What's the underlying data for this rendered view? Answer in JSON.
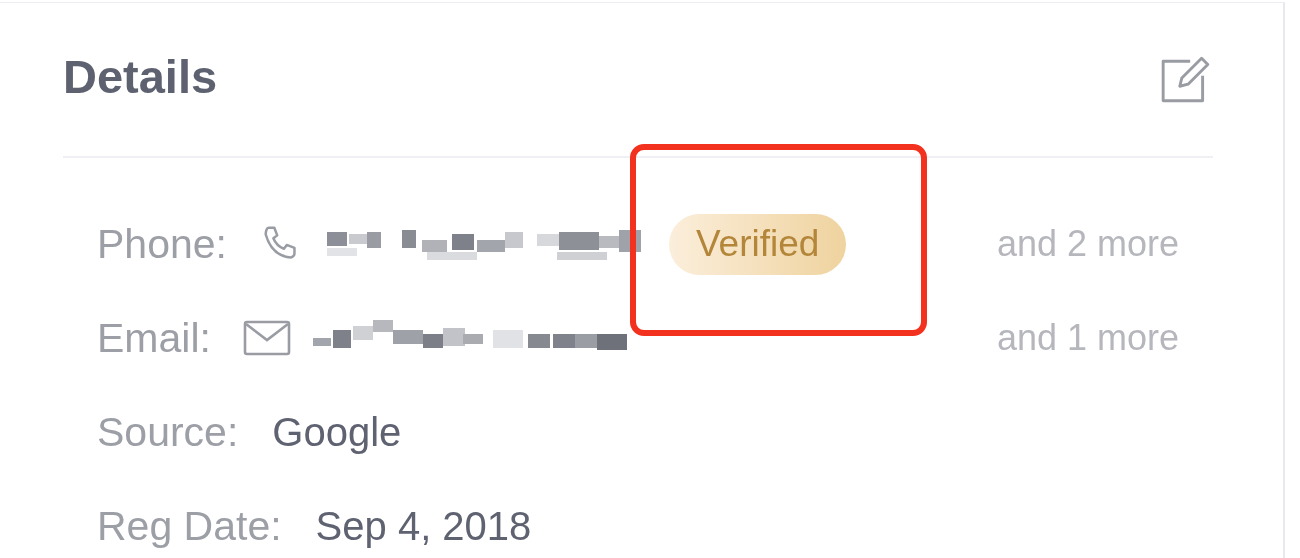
{
  "panel": {
    "title": "Details"
  },
  "fields": [
    {
      "kind": "phone",
      "label": "Phone:",
      "redacted": true,
      "badge": "Verified",
      "highlighted": true,
      "extra": "and 2 more"
    },
    {
      "kind": "email",
      "label": "Email:",
      "redacted": true,
      "highlighted": false,
      "extra": "and 1 more"
    },
    {
      "kind": "text",
      "label": "Source:",
      "value": "Google",
      "highlighted": false
    },
    {
      "kind": "text",
      "label": "Reg Date:",
      "value": "Sep 4, 2018",
      "highlighted": false
    }
  ]
}
